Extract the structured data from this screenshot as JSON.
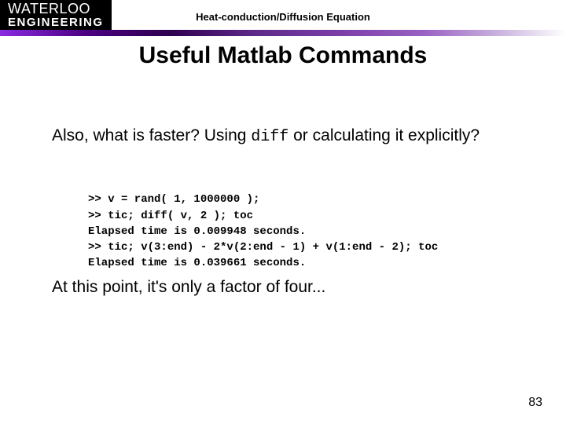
{
  "logo": {
    "top": "WATERLOO",
    "bottom": "ENGINEERING"
  },
  "topic": "Heat-conduction/Diffusion Equation",
  "title": "Useful Matlab Commands",
  "intro": {
    "prefix": "Also, what is faster?  Using ",
    "code": "diff",
    "suffix": " or calculating it explicitly?"
  },
  "code": {
    "lines": [
      ">> v = rand( 1, 1000000 );",
      ">> tic; diff( v, 2 ); toc",
      "Elapsed time is 0.009948 seconds.",
      ">> tic; v(3:end) - 2*v(2:end - 1) + v(1:end - 2); toc",
      "Elapsed time is 0.039661 seconds."
    ]
  },
  "conclusion": "At this point, it's only a factor of four...",
  "page_number": "83"
}
